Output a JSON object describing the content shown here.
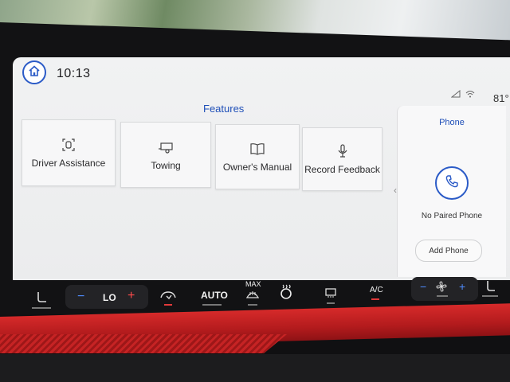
{
  "header": {
    "time": "10:13",
    "temperature": "81°"
  },
  "features": {
    "title": "Features",
    "tiles": [
      {
        "label": "Driver Assistance",
        "icon": "driver-assist-icon"
      },
      {
        "label": "Towing",
        "icon": "trailer-icon"
      },
      {
        "label": "Owner's Manual",
        "icon": "book-icon"
      },
      {
        "label": "Record Feedback",
        "icon": "microphone-icon"
      }
    ]
  },
  "phone": {
    "title": "Phone",
    "status": "No Paired Phone",
    "add_button": "Add Phone"
  },
  "climate": {
    "temp_left": "LO",
    "fan_mode": "AUTO",
    "defrost_label": "MAX",
    "ac_label": "A/C",
    "minus": "−",
    "plus": "+"
  },
  "colors": {
    "accent": "#2b5bc7",
    "trim_red": "#c62324"
  }
}
